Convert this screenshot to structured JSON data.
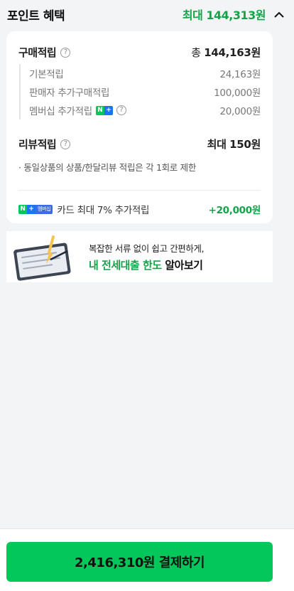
{
  "header": {
    "title": "포인트 혜택",
    "max_text": "최대 144,313원"
  },
  "purchase": {
    "label": "구매적립",
    "total_prefix": "총",
    "total_value": "144,163원",
    "items": [
      {
        "label": "기본적립",
        "value": "24,163원"
      },
      {
        "label": "판매자 추가구매적립",
        "value": "100,000원"
      },
      {
        "label": "멤버십 추가적립",
        "value": "20,000원"
      }
    ]
  },
  "review": {
    "label": "리뷰적립",
    "value_prefix": "최대",
    "value": "150원",
    "note": "· 동일상품의 상품/한달리뷰 적립은 각 1회로 제한"
  },
  "card_benefit": {
    "badge_text": "멤버십",
    "label": "카드 최대 7% 추가적립",
    "value": "+20,000원"
  },
  "banner": {
    "line1": "복잡한 서류 없이 쉽고 간편하게,",
    "line2_green": "내 전세대출 한도",
    "line2_black": "알아보기"
  },
  "footer": {
    "pay_label": "2,416,310원 결제하기"
  },
  "colors": {
    "accent_green": "#03c75a",
    "text_green": "#15a34a",
    "background": "#f3f4f6"
  }
}
